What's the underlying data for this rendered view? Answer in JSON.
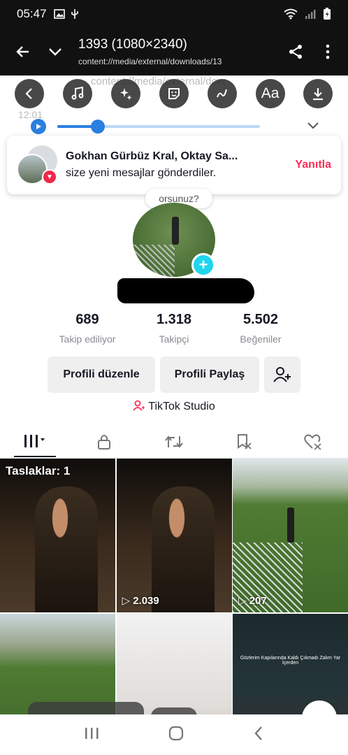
{
  "status_bar": {
    "time": "05:47"
  },
  "viewer": {
    "title": "1393 (1080×2340)",
    "path": "content://media/external/downloads/13",
    "ghost_path": "content://media/external/dow"
  },
  "ghost_status": {
    "time": "12:01"
  },
  "editor_tools": [
    {
      "icon": "back-chevron-icon"
    },
    {
      "icon": "music-icon"
    },
    {
      "icon": "sparkles-icon"
    },
    {
      "icon": "sticker-icon"
    },
    {
      "icon": "draw-icon"
    },
    {
      "icon": "text-icon",
      "label": "Aa"
    },
    {
      "icon": "download-icon"
    }
  ],
  "audio": {
    "progress": 0.2
  },
  "notification": {
    "names": "Gokhan Gürbüz Kral, Oktay Sa...",
    "message": "size yeni mesajlar gönderdiler.",
    "reply": "Yanıtla"
  },
  "profile": {
    "bubble": "orsunuz?",
    "stats": [
      {
        "value": "689",
        "label": "Takip ediliyor"
      },
      {
        "value": "1.318",
        "label": "Takipçi"
      },
      {
        "value": "5.502",
        "label": "Beğeniler"
      }
    ],
    "edit_button": "Profili düzenle",
    "share_button": "Profili Paylaş",
    "studio": "TikTok Studio"
  },
  "grid": {
    "draft_label": "Taslaklar: 1",
    "items": [
      {
        "style": "night",
        "count": ""
      },
      {
        "style": "night",
        "count": "2.039"
      },
      {
        "style": "field",
        "count": "207"
      },
      {
        "style": "field2",
        "count": ""
      },
      {
        "style": "indoor",
        "count": ""
      },
      {
        "style": "dark2",
        "count": ""
      }
    ],
    "caption_tiktok": "Gözlerim Kapılarında Kaldı Çıkmadı Zalım Yar İçerden"
  },
  "colors": {
    "accent": "#fe2c55",
    "teal": "#20d5ec",
    "audio": "#2a7fe0"
  }
}
